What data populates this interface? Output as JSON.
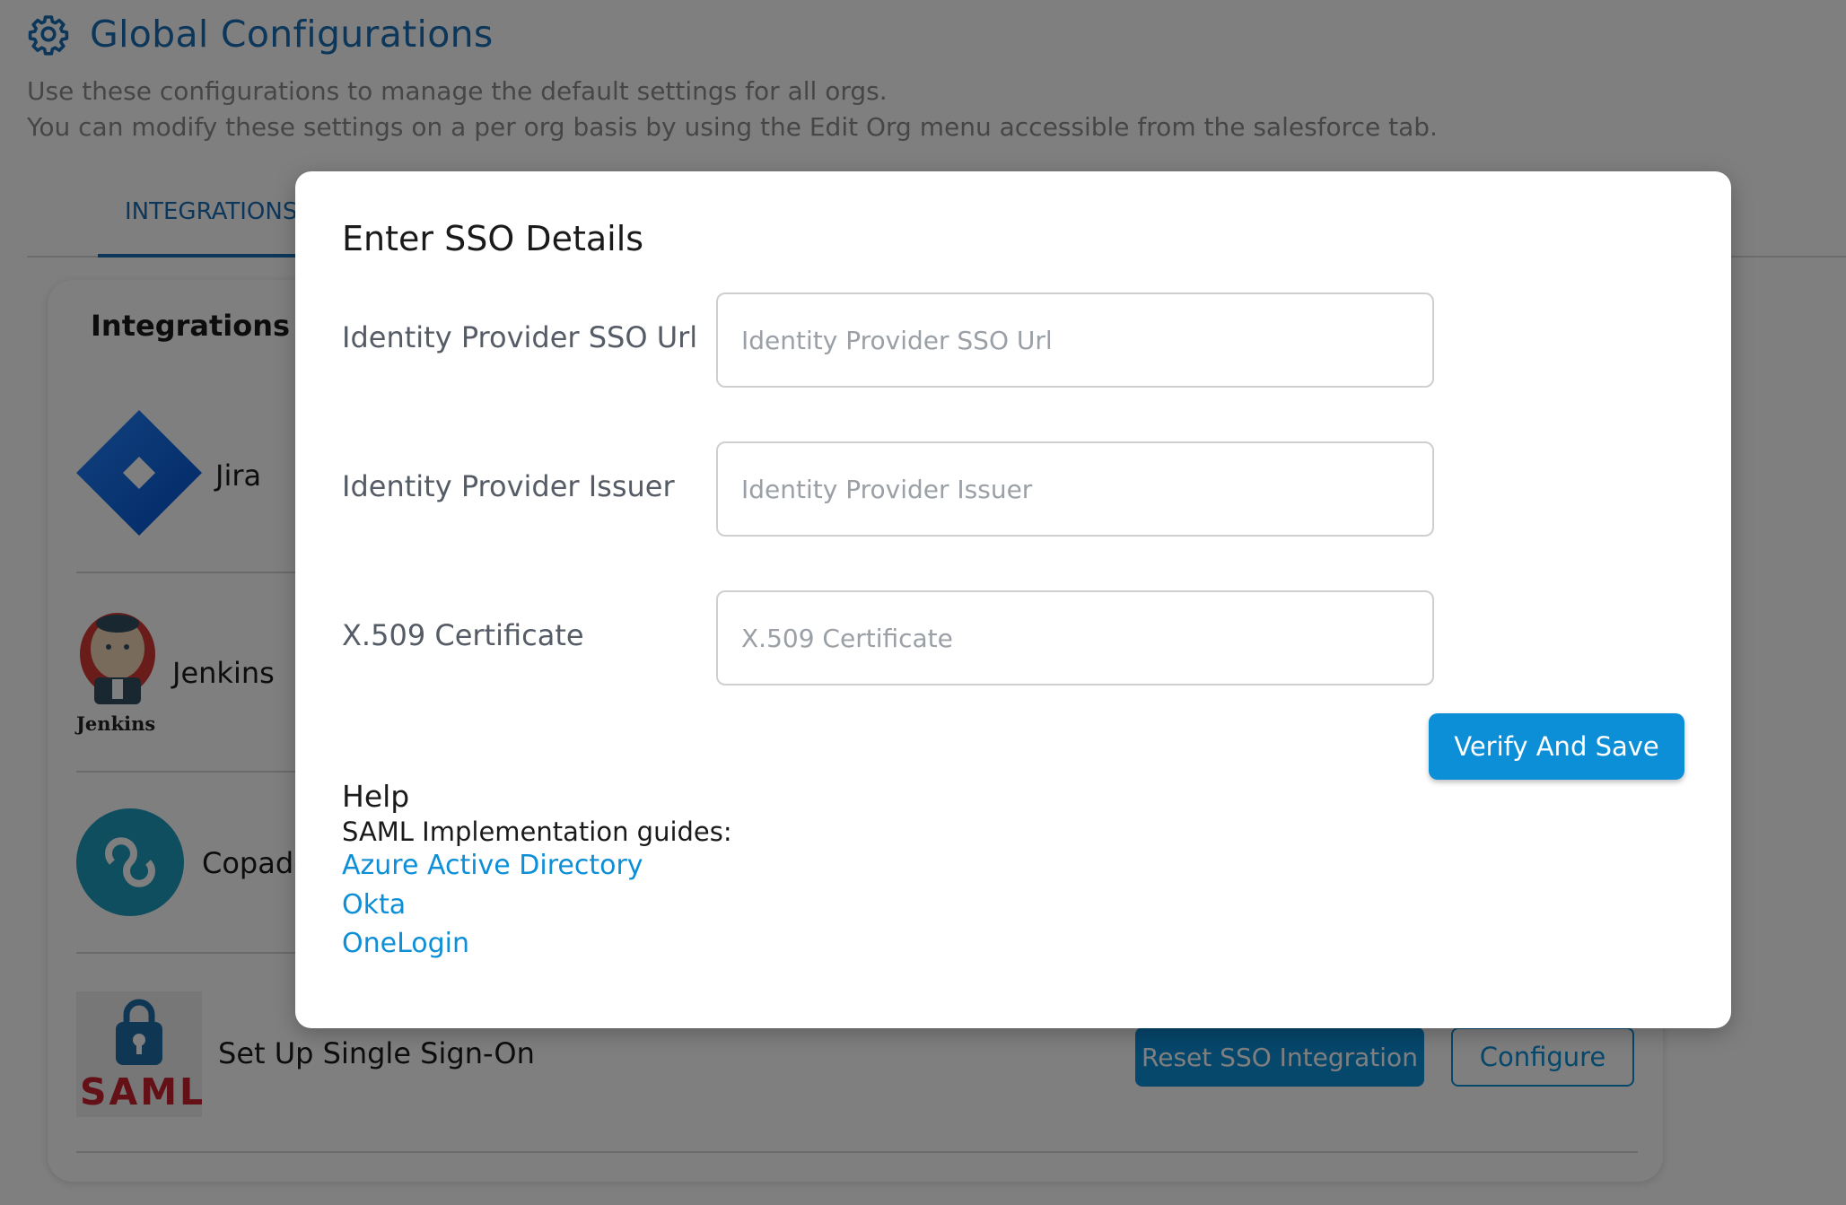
{
  "header": {
    "title": "Global Configurations",
    "description_line1": "Use these configurations to manage the default settings for all orgs.",
    "description_line2": "You can modify these settings on a per org basis by using the Edit Org menu accessible from the salesforce tab.",
    "icon": "gear-icon"
  },
  "tabs": [
    {
      "label": "INTEGRATIONS",
      "active": true
    }
  ],
  "integrations": {
    "title": "Integrations",
    "items": [
      {
        "name": "Jira",
        "icon": "jira-logo"
      },
      {
        "name": "Jenkins",
        "icon": "jenkins-logo",
        "logo_caption": "Jenkins"
      },
      {
        "name": "Copado",
        "icon": "copado-logo"
      },
      {
        "name": "Set Up Single Sign-On",
        "icon": "saml-logo",
        "logo_caption": "SAML"
      }
    ],
    "reset_button": "Reset SSO Integration",
    "configure_button": "Configure"
  },
  "modal": {
    "title": "Enter SSO Details",
    "fields": [
      {
        "label": "Identity Provider SSO Url",
        "placeholder": "Identity Provider SSO Url",
        "value": ""
      },
      {
        "label": "Identity Provider Issuer",
        "placeholder": "Identity Provider Issuer",
        "value": ""
      },
      {
        "label": "X.509 Certificate",
        "placeholder": "X.509 Certificate",
        "value": ""
      }
    ],
    "submit_button": "Verify And Save",
    "help": {
      "title": "Help",
      "subtitle": "SAML Implementation guides:",
      "links": [
        "Azure Active Directory",
        "Okta",
        "OneLogin"
      ]
    }
  },
  "colors": {
    "accent": "#0d8fd8",
    "title_blue": "#1b6fb5",
    "overlay": "rgba(0,0,0,0.5)"
  }
}
